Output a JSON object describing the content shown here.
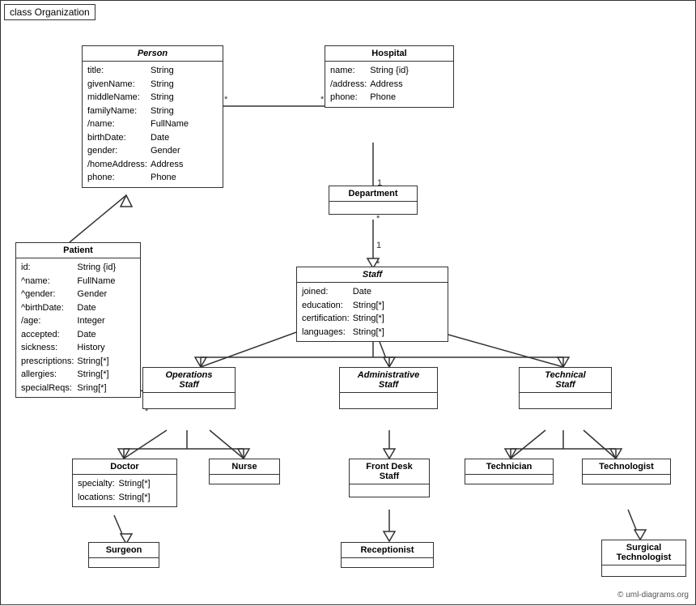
{
  "diagram": {
    "title": "class Organization",
    "copyright": "© uml-diagrams.org"
  },
  "classes": {
    "person": {
      "name": "Person",
      "italic": true,
      "attrs": [
        [
          "title:",
          "String"
        ],
        [
          "givenName:",
          "String"
        ],
        [
          "middleName:",
          "String"
        ],
        [
          "familyName:",
          "String"
        ],
        [
          "/name:",
          "FullName"
        ],
        [
          "birthDate:",
          "Date"
        ],
        [
          "gender:",
          "Gender"
        ],
        [
          "/homeAddress:",
          "Address"
        ],
        [
          "phone:",
          "Phone"
        ]
      ]
    },
    "hospital": {
      "name": "Hospital",
      "italic": false,
      "attrs": [
        [
          "name:",
          "String {id}"
        ],
        [
          "/address:",
          "Address"
        ],
        [
          "phone:",
          "Phone"
        ]
      ]
    },
    "patient": {
      "name": "Patient",
      "italic": false,
      "attrs": [
        [
          "id:",
          "String {id}"
        ],
        [
          "^name:",
          "FullName"
        ],
        [
          "^gender:",
          "Gender"
        ],
        [
          "^birthDate:",
          "Date"
        ],
        [
          "/age:",
          "Integer"
        ],
        [
          "accepted:",
          "Date"
        ],
        [
          "sickness:",
          "History"
        ],
        [
          "prescriptions:",
          "String[*]"
        ],
        [
          "allergies:",
          "String[*]"
        ],
        [
          "specialReqs:",
          "Sring[*]"
        ]
      ]
    },
    "department": {
      "name": "Department",
      "italic": false,
      "attrs": []
    },
    "staff": {
      "name": "Staff",
      "italic": true,
      "attrs": [
        [
          "joined:",
          "Date"
        ],
        [
          "education:",
          "String[*]"
        ],
        [
          "certification:",
          "String[*]"
        ],
        [
          "languages:",
          "String[*]"
        ]
      ]
    },
    "operations_staff": {
      "name": "Operations\nStaff",
      "italic": true,
      "attrs": []
    },
    "administrative_staff": {
      "name": "Administrative\nStaff",
      "italic": true,
      "attrs": []
    },
    "technical_staff": {
      "name": "Technical\nStaff",
      "italic": true,
      "attrs": []
    },
    "doctor": {
      "name": "Doctor",
      "italic": false,
      "attrs": [
        [
          "specialty:",
          "String[*]"
        ],
        [
          "locations:",
          "String[*]"
        ]
      ]
    },
    "nurse": {
      "name": "Nurse",
      "italic": false,
      "attrs": []
    },
    "front_desk_staff": {
      "name": "Front Desk\nStaff",
      "italic": false,
      "attrs": []
    },
    "technician": {
      "name": "Technician",
      "italic": false,
      "attrs": []
    },
    "technologist": {
      "name": "Technologist",
      "italic": false,
      "attrs": []
    },
    "surgeon": {
      "name": "Surgeon",
      "italic": false,
      "attrs": []
    },
    "receptionist": {
      "name": "Receptionist",
      "italic": false,
      "attrs": []
    },
    "surgical_technologist": {
      "name": "Surgical\nTechnologist",
      "italic": false,
      "attrs": []
    }
  }
}
